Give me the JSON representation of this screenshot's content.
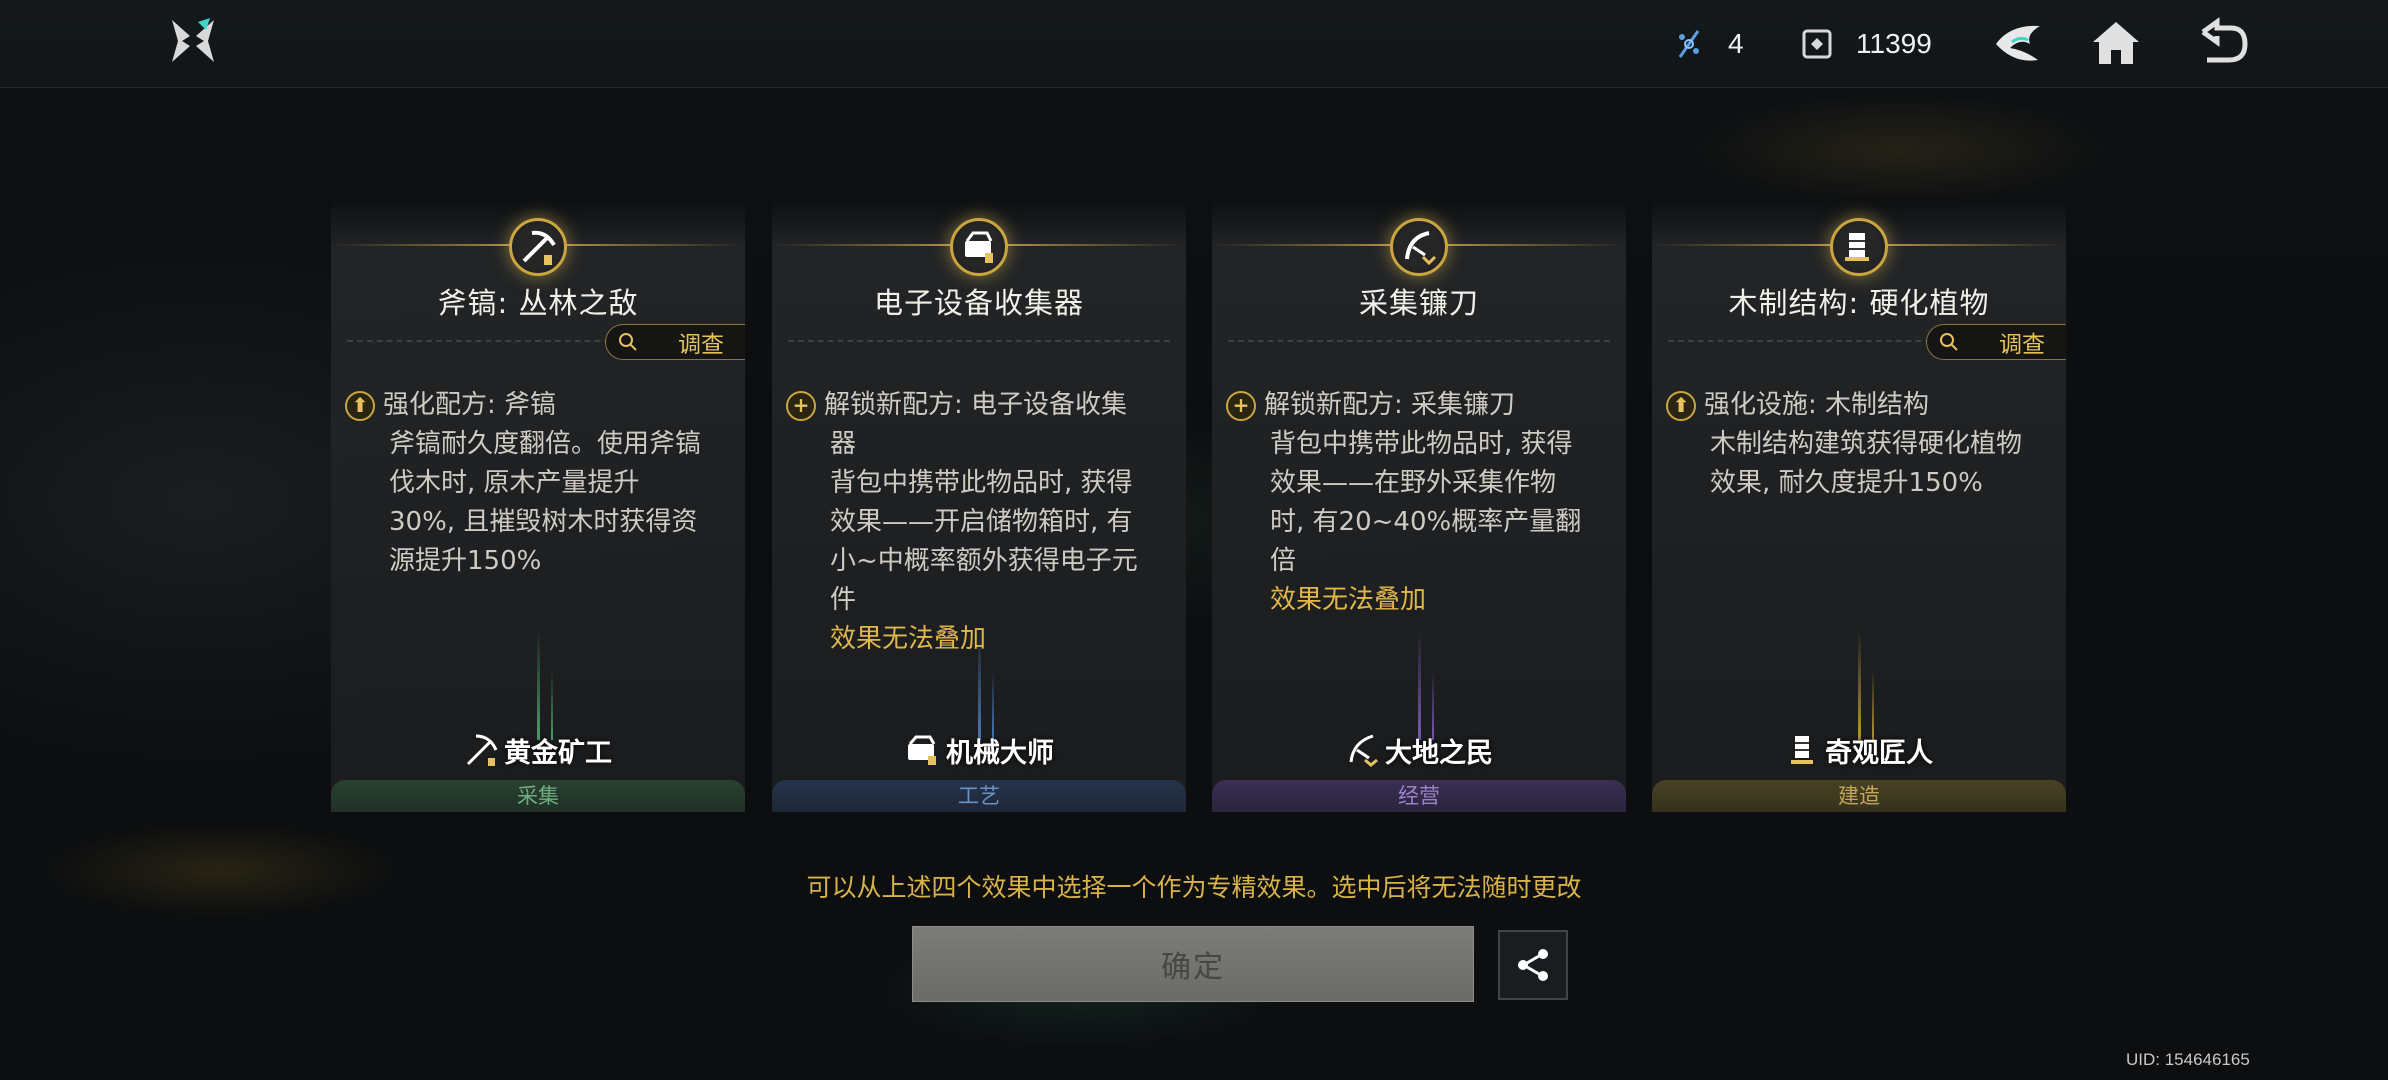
{
  "topbar": {
    "resource1": {
      "icon": "crystal-icon",
      "value": "4"
    },
    "resource2": {
      "icon": "currency-icon",
      "value": "11399"
    },
    "icons": [
      "emblem-icon",
      "home-icon",
      "back-icon"
    ]
  },
  "cards": [
    {
      "title": "斧镐: 丛林之敌",
      "inspect": "调查",
      "effect_head": "强化配方: 斧镐",
      "effect_lines": [
        "斧镐耐久度翻倍。使用斧镐",
        "伐木时, 原木产量提升",
        "30%, 且摧毁树木时获得资",
        "源提升150%"
      ],
      "warning": "",
      "role": "黄金矿工",
      "category": "采集",
      "color": "#4a9e6a"
    },
    {
      "title": "电子设备收集器",
      "inspect": "",
      "effect_head": "解锁新配方: 电子设备收集",
      "effect_lines": [
        "器",
        "背包中携带此物品时, 获得",
        "效果——开启储物箱时, 有",
        "小~中概率额外获得电子元",
        "件"
      ],
      "warning": "效果无法叠加",
      "role": "机械大师",
      "category": "工艺",
      "color": "#4a7ab8"
    },
    {
      "title": "采集镰刀",
      "inspect": "",
      "effect_head": "解锁新配方: 采集镰刀",
      "effect_lines": [
        "背包中携带此物品时, 获得",
        "效果——在野外采集作物",
        "时, 有20~40%概率产量翻",
        "倍"
      ],
      "warning": "效果无法叠加",
      "role": "大地之民",
      "category": "经营",
      "color": "#7e5ab8"
    },
    {
      "title": "木制结构: 硬化植物",
      "inspect": "调查",
      "effect_head": "强化设施: 木制结构",
      "effect_lines": [
        "木制结构建筑获得硬化植物",
        "效果, 耐久度提升150%"
      ],
      "warning": "",
      "role": "奇观匠人",
      "category": "建造",
      "color": "#b8963a"
    }
  ],
  "note": "可以从上述四个效果中选择一个作为专精效果。选中后将无法随时更改",
  "confirm_label": "确定",
  "uid": "UID: 154646165",
  "colors": {
    "gold": "#c9a640",
    "warn": "#e1b74a",
    "accent_cyan": "#3fd6c8"
  }
}
